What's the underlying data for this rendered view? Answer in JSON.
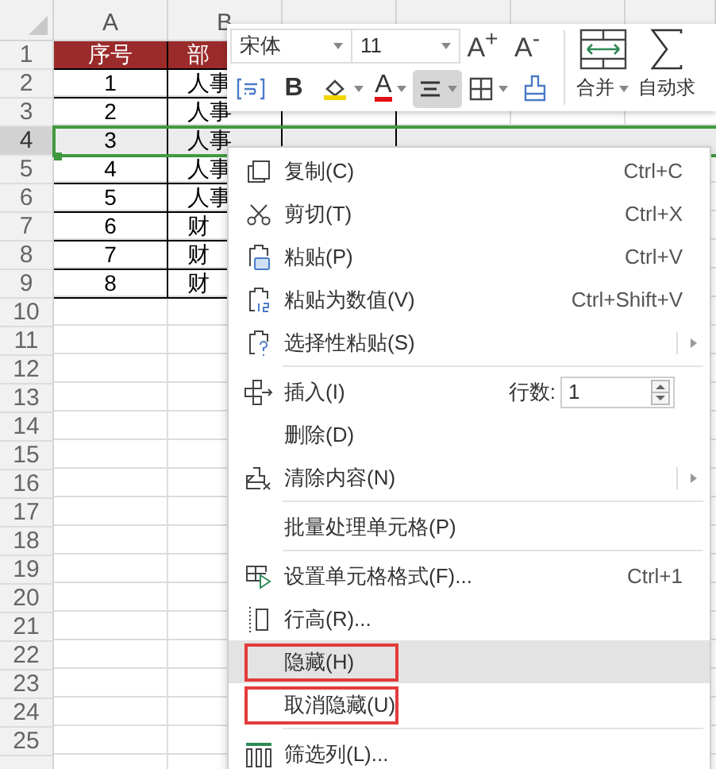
{
  "spreadsheet": {
    "columns": [
      "A",
      "B"
    ],
    "rows": [
      {
        "number": "1",
        "kind": "header",
        "selected": false,
        "cells": [
          "序号",
          "部"
        ]
      },
      {
        "number": "2",
        "kind": "data",
        "selected": false,
        "cells": [
          "1",
          "人事"
        ]
      },
      {
        "number": "3",
        "kind": "data",
        "selected": false,
        "cells": [
          "2",
          "人事"
        ]
      },
      {
        "number": "4",
        "kind": "data",
        "selected": true,
        "cells": [
          "3",
          "人事"
        ]
      },
      {
        "number": "5",
        "kind": "data",
        "selected": false,
        "cells": [
          "4",
          "人事"
        ]
      },
      {
        "number": "6",
        "kind": "data",
        "selected": false,
        "cells": [
          "5",
          "人事"
        ]
      },
      {
        "number": "7",
        "kind": "data",
        "selected": false,
        "cells": [
          "6",
          "财"
        ]
      },
      {
        "number": "8",
        "kind": "data",
        "selected": false,
        "cells": [
          "7",
          "财"
        ]
      },
      {
        "number": "9",
        "kind": "data",
        "selected": false,
        "cells": [
          "8",
          "财"
        ]
      },
      {
        "number": "10",
        "kind": "empty",
        "selected": false,
        "cells": []
      },
      {
        "number": "11",
        "kind": "empty",
        "selected": false,
        "cells": []
      },
      {
        "number": "12",
        "kind": "empty",
        "selected": false,
        "cells": []
      },
      {
        "number": "13",
        "kind": "empty",
        "selected": false,
        "cells": []
      },
      {
        "number": "14",
        "kind": "empty",
        "selected": false,
        "cells": []
      },
      {
        "number": "15",
        "kind": "empty",
        "selected": false,
        "cells": []
      },
      {
        "number": "16",
        "kind": "empty",
        "selected": false,
        "cells": []
      },
      {
        "number": "17",
        "kind": "empty",
        "selected": false,
        "cells": []
      },
      {
        "number": "18",
        "kind": "empty",
        "selected": false,
        "cells": []
      },
      {
        "number": "19",
        "kind": "empty",
        "selected": false,
        "cells": []
      },
      {
        "number": "20",
        "kind": "empty",
        "selected": false,
        "cells": []
      },
      {
        "number": "21",
        "kind": "empty",
        "selected": false,
        "cells": []
      },
      {
        "number": "22",
        "kind": "empty",
        "selected": false,
        "cells": []
      },
      {
        "number": "23",
        "kind": "empty",
        "selected": false,
        "cells": []
      },
      {
        "number": "24",
        "kind": "empty",
        "selected": false,
        "cells": []
      },
      {
        "number": "25",
        "kind": "empty",
        "selected": false,
        "cells": []
      }
    ]
  },
  "mini_toolbar": {
    "font": "宋体",
    "size": "11",
    "size_buttons": [
      "A$^{+}$",
      "A$^{-}$"
    ],
    "format_buttons": [
      {
        "kind": "wrap",
        "dropdown": false,
        "selected": false
      },
      {
        "kind": "bold",
        "label": "B",
        "dropdown": false,
        "selected": false
      },
      {
        "kind": "fill",
        "dropdown": true,
        "selected": false
      },
      {
        "kind": "fontcolor",
        "label": "A",
        "dropdown": true,
        "selected": false
      },
      {
        "kind": "align",
        "dropdown": true,
        "selected": true
      },
      {
        "kind": "border",
        "dropdown": true,
        "selected": false
      },
      {
        "kind": "painter",
        "dropdown": false,
        "selected": false
      }
    ],
    "large_buttons": [
      {
        "kind": "merge",
        "label": "合并",
        "dropdown": true
      },
      {
        "kind": "sum",
        "label": "自动求",
        "dropdown": false
      }
    ]
  },
  "context_menu": {
    "items": [
      {
        "kind": "copy",
        "label": "复制(C)",
        "shortcut": "Ctrl+C",
        "submenu": false,
        "hovered": false,
        "annotated": false
      },
      {
        "kind": "cut",
        "label": "剪切(T)",
        "shortcut": "Ctrl+X",
        "submenu": false,
        "hovered": false,
        "annotated": false
      },
      {
        "kind": "paste",
        "label": "粘贴(P)",
        "shortcut": "Ctrl+V",
        "submenu": false,
        "hovered": false,
        "annotated": false
      },
      {
        "kind": "pastevalues",
        "label": "粘贴为数值(V)",
        "shortcut": "Ctrl+Shift+V",
        "submenu": false,
        "hovered": false,
        "annotated": false
      },
      {
        "kind": "pastespecial",
        "label": "选择性粘贴(S)",
        "submenu": true,
        "hovered": false,
        "annotated": false
      },
      {
        "kind": "separator"
      },
      {
        "kind": "insert",
        "label": "插入(I)",
        "count_label": "行数:",
        "count_value": "1",
        "submenu": false,
        "hovered": false,
        "annotated": false
      },
      {
        "kind": "plain",
        "label": "删除(D)",
        "submenu": false,
        "hovered": false,
        "annotated": false
      },
      {
        "kind": "clear",
        "label": "清除内容(N)",
        "submenu": true,
        "hovered": false,
        "annotated": false
      },
      {
        "kind": "separator"
      },
      {
        "kind": "plain",
        "label": "批量处理单元格(P)",
        "submenu": false,
        "hovered": false,
        "annotated": false
      },
      {
        "kind": "separator"
      },
      {
        "kind": "format",
        "label": "设置单元格格式(F)...",
        "shortcut": "Ctrl+1",
        "submenu": false,
        "hovered": false,
        "annotated": false
      },
      {
        "kind": "rowheight",
        "label": "行高(R)...",
        "submenu": false,
        "hovered": false,
        "annotated": false
      },
      {
        "kind": "plain",
        "label": "隐藏(H)",
        "submenu": false,
        "hovered": true,
        "annotated": true
      },
      {
        "kind": "plain",
        "label": "取消隐藏(U)",
        "submenu": false,
        "hovered": false,
        "annotated": true
      },
      {
        "kind": "separator"
      },
      {
        "kind": "filtercolumns",
        "label": "筛选列(L)...",
        "submenu": false,
        "hovered": false,
        "annotated": false
      }
    ]
  }
}
